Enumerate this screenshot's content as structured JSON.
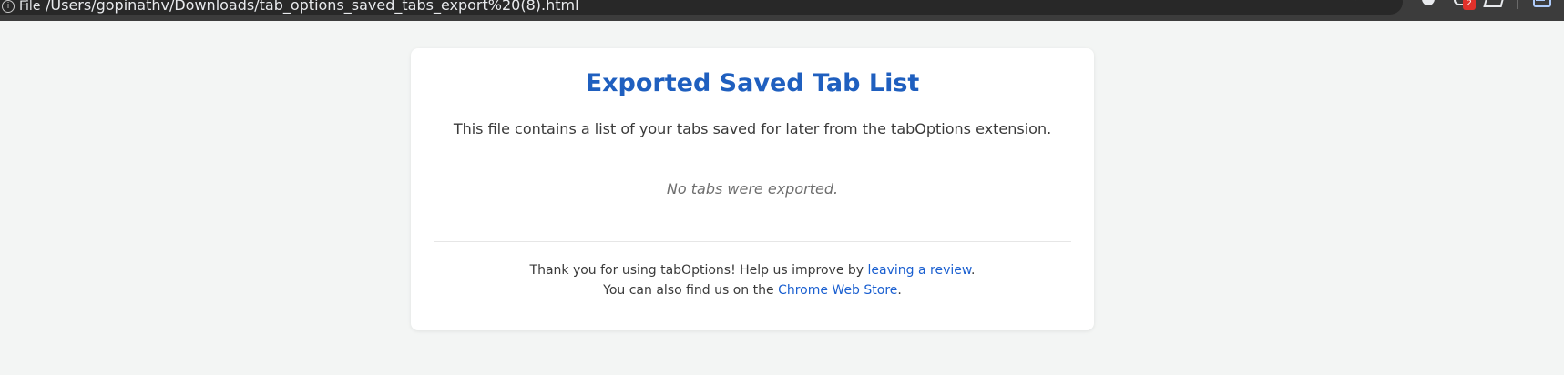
{
  "browser": {
    "file_label": "File",
    "url": "/Users/gopinathv/Downloads/tab_options_saved_tabs_export%20(8).html",
    "extension_badge": "2",
    "icons": [
      "info-icon",
      "star-icon",
      "extension-icon",
      "puzzle-icon",
      "share-icon",
      "profile-icon"
    ]
  },
  "page": {
    "title": "Exported Saved Tab List",
    "description": "This file contains a list of your tabs saved for later from the tabOptions extension.",
    "empty_message": "No tabs were exported.",
    "footer": {
      "line1_prefix": "Thank you for using tabOptions! Help us improve by ",
      "review_link": "leaving a review",
      "line1_suffix": ".",
      "line2_prefix": "You can also find us on the ",
      "store_link": "Chrome Web Store",
      "line2_suffix": "."
    }
  },
  "colors": {
    "title": "#1f5fbf",
    "link": "#1a5fd0",
    "page_background": "#f3f5f4",
    "card_background": "#ffffff",
    "browser_bar": "#282828"
  }
}
